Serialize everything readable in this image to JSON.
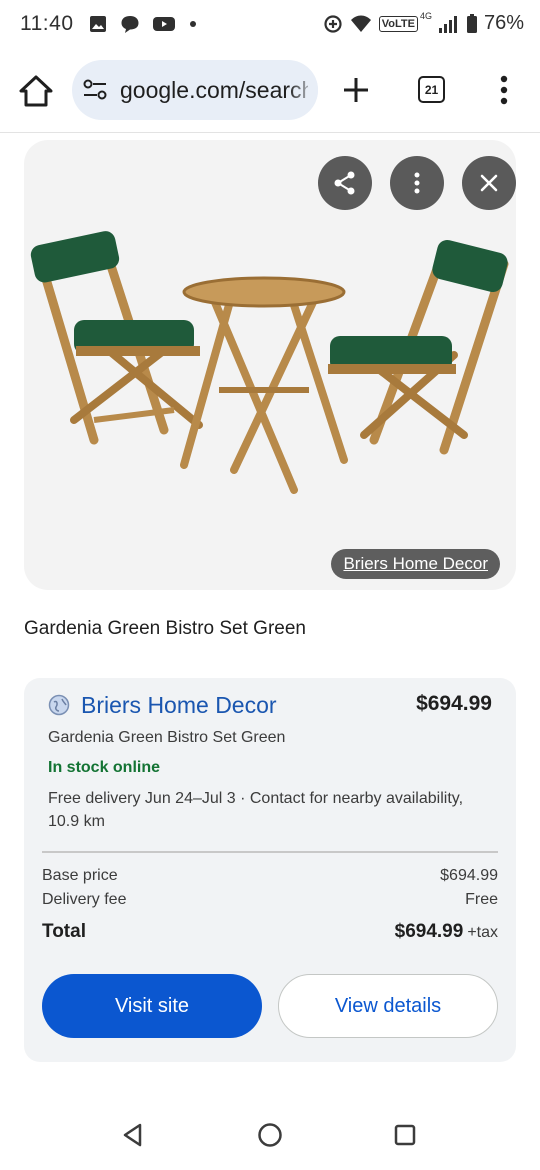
{
  "status_bar": {
    "time": "11:40",
    "network_label": "VoLTE",
    "network_type": "4G",
    "battery_percent": "76%",
    "left_icons": [
      "gallery-icon",
      "chat-bubble-icon",
      "youtube-icon",
      "dot-icon"
    ],
    "right_icons": [
      "data-saver-icon",
      "wifi-icon",
      "signal-icon",
      "battery-icon"
    ]
  },
  "browser": {
    "url": "google.com/search",
    "tab_count": "21",
    "icons": [
      "home-icon",
      "tune-icon",
      "plus-icon",
      "tabs-icon",
      "more-vert-icon"
    ]
  },
  "image_card": {
    "source_label": "Briers Home Decor",
    "actions": [
      "share-icon",
      "more-vert-icon",
      "close-icon"
    ]
  },
  "product": {
    "title": "Gardenia Green Bistro Set Green"
  },
  "offer": {
    "seller": "Briers Home Decor",
    "price": "$694.99",
    "product_name": "Gardenia Green Bistro Set Green",
    "stock": "In stock online",
    "delivery": "Free delivery Jun 24–Jul 3 · Contact for nearby availability, 10.9 km",
    "rows": [
      {
        "label": "Base price",
        "value": "$694.99"
      },
      {
        "label": "Delivery fee",
        "value": "Free"
      }
    ],
    "total_label": "Total",
    "total_value": "$694.99",
    "tax_label": "+tax",
    "visit_label": "Visit site",
    "details_label": "View details"
  },
  "colors": {
    "accent": "#0b57d0",
    "seller_link": "#1a56b0",
    "in_stock": "#137333",
    "cushion": "#1f5a3a",
    "wood": "#b88a4a"
  },
  "nav": {
    "icons": [
      "back-icon",
      "home-circle-icon",
      "recents-icon"
    ]
  }
}
